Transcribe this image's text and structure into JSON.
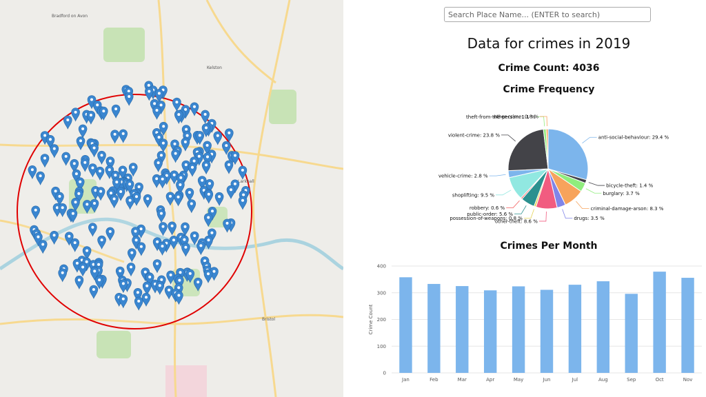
{
  "search": {
    "placeholder": "Search Place Name... (ENTER to search)"
  },
  "header": {
    "title": "Data for crimes in 2019",
    "crime_count_label": "Crime Count: 4036"
  },
  "pie_title": "Crime Frequency",
  "bar_title": "Crimes Per Month",
  "map": {
    "place_labels": [
      "Bradford on Avon",
      "Larkhall",
      "Bristol",
      "Kelston"
    ],
    "circle_color": "#e00000",
    "marker_color": "#3a86d0",
    "marker_icon": "map-pin-icon"
  },
  "chart_data": [
    {
      "type": "pie",
      "title": "Crime Frequency",
      "slices": [
        {
          "label": "anti-social-behaviour",
          "percent": 29.4,
          "color": "#7cb5ec"
        },
        {
          "label": "bicycle-theft",
          "percent": 1.4,
          "color": "#434348"
        },
        {
          "label": "burglary",
          "percent": 3.7,
          "color": "#90ed7d"
        },
        {
          "label": "criminal-damage-arson",
          "percent": 8.3,
          "color": "#f7a35c"
        },
        {
          "label": "drugs",
          "percent": 3.5,
          "color": "#8085e9"
        },
        {
          "label": "other-theft",
          "percent": 8.6,
          "color": "#f15c80"
        },
        {
          "label": "possession-of-weapons",
          "percent": 0.8,
          "color": "#e4d354"
        },
        {
          "label": "public-order",
          "percent": 5.6,
          "color": "#2b908f"
        },
        {
          "label": "robbery",
          "percent": 0.6,
          "color": "#f45b5b"
        },
        {
          "label": "shoplifting",
          "percent": 9.5,
          "color": "#91e8e1"
        },
        {
          "label": "vehicle-crime",
          "percent": 2.8,
          "color": "#7cb5ec"
        },
        {
          "label": "violent-crime",
          "percent": 23.8,
          "color": "#434348"
        },
        {
          "label": "theft-from-the-person",
          "percent": 1.1,
          "color": "#90ed7d"
        },
        {
          "label": "other-crime",
          "percent": 0.8,
          "color": "#f7a35c"
        }
      ]
    },
    {
      "type": "bar",
      "title": "Crimes Per Month",
      "categories": [
        "Jan",
        "Feb",
        "Mar",
        "Apr",
        "May",
        "Jun",
        "Jul",
        "Aug",
        "Sep",
        "Oct",
        "Nov"
      ],
      "values": [
        358,
        333,
        325,
        309,
        324,
        311,
        330,
        343,
        296,
        379,
        356
      ],
      "ylabel": "Crime Count",
      "ylim": [
        0,
        400
      ],
      "yticks": [
        0,
        100,
        200,
        300,
        400
      ],
      "color": "#7cb5ec",
      "grid": true
    }
  ]
}
